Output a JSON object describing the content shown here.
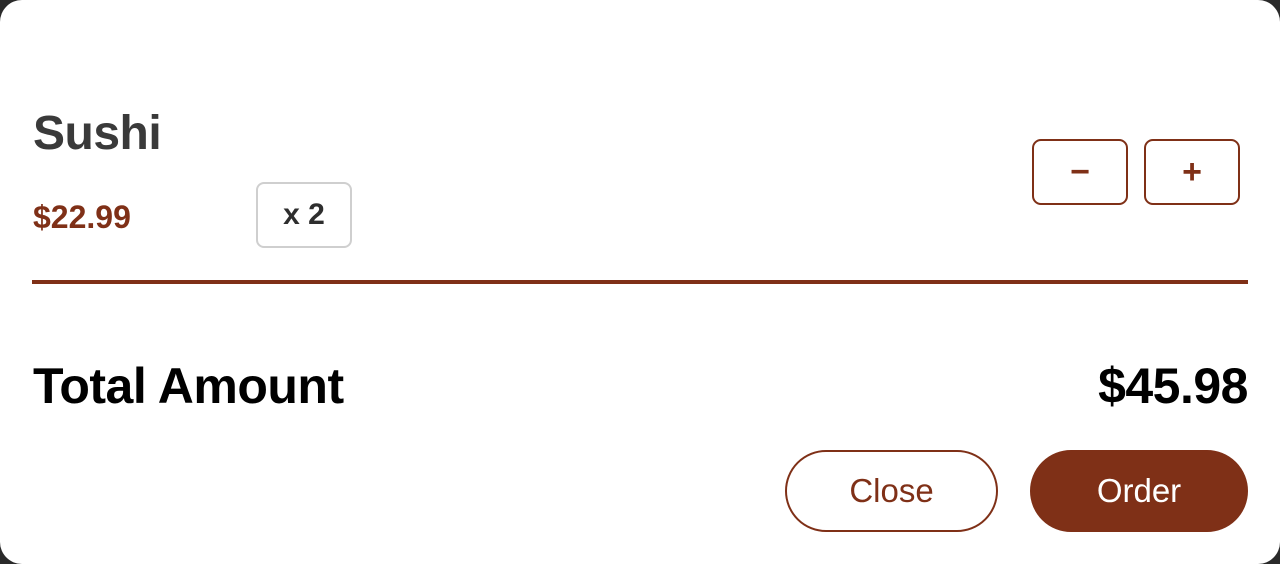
{
  "cart_item": {
    "name": "Sushi",
    "price": "$22.99",
    "quantity_label": "x 2",
    "decrement_label": "−",
    "increment_label": "+"
  },
  "summary": {
    "total_label": "Total Amount",
    "total_value": "$45.98"
  },
  "actions": {
    "close_label": "Close",
    "order_label": "Order"
  },
  "colors": {
    "accent": "#7f3017",
    "text_dark": "#3a3a3a",
    "badge_border": "#cfcfcf"
  }
}
